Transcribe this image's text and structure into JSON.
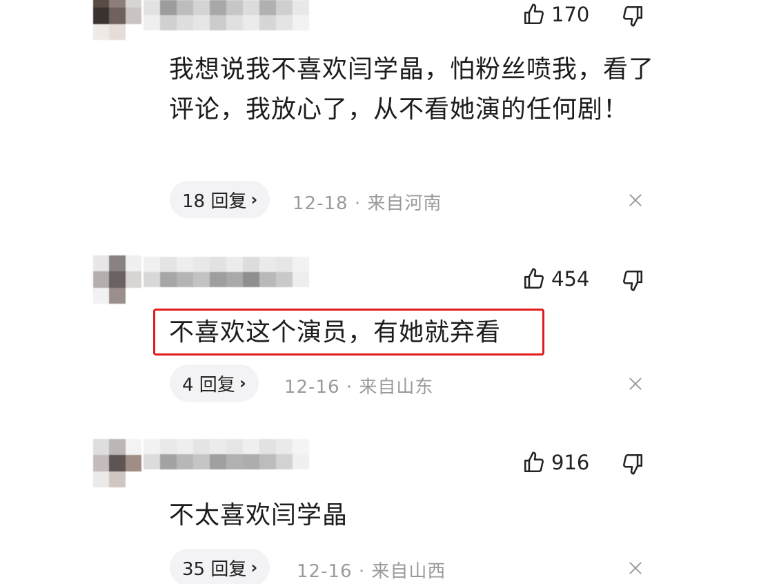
{
  "comments": [
    {
      "likes": "170",
      "text": "我想说我不喜欢闫学晶，怕粉丝喷我，看了评论，我放心了，从不看她演的任何剧！",
      "replies_label": "18 回复",
      "date": "12-18",
      "separator": "·",
      "location": "来自河南",
      "highlighted": false
    },
    {
      "likes": "454",
      "text": "不喜欢这个演员，有她就弃看",
      "replies_label": "4 回复",
      "date": "12-16",
      "separator": "·",
      "location": "来自山东",
      "highlighted": true,
      "highlight_color": "#e11b1b"
    },
    {
      "likes": "916",
      "text": "不太喜欢闫学晶",
      "replies_label": "35 回复",
      "date": "12-16",
      "separator": "·",
      "location": "来自山西",
      "highlighted": false
    }
  ],
  "icons": {
    "like": "thumbs-up-icon",
    "dislike": "thumbs-down-icon",
    "close": "close-icon",
    "chevron": "chevron-right-icon",
    "chevron_glyph": "›"
  },
  "colors": {
    "highlight": "#e11b1b",
    "meta_text": "#9a9a9a",
    "reply_bg": "#f3f3f5"
  }
}
